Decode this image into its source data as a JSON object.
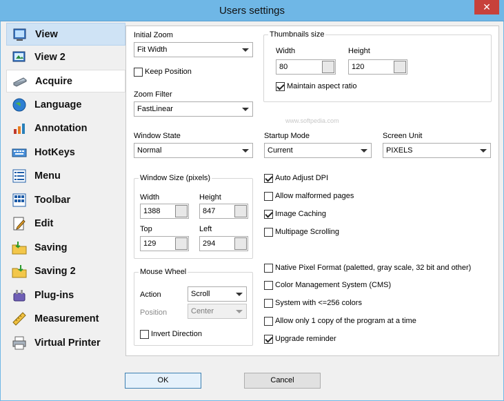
{
  "window": {
    "title": "Users settings",
    "close_glyph": "✕"
  },
  "nav": {
    "items": [
      {
        "label": "View",
        "icon": "view-icon"
      },
      {
        "label": "View 2",
        "icon": "view2-icon"
      },
      {
        "label": "Acquire",
        "icon": "scanner-icon"
      },
      {
        "label": "Language",
        "icon": "globe-icon"
      },
      {
        "label": "Annotation",
        "icon": "annotation-icon"
      },
      {
        "label": "HotKeys",
        "icon": "keyboard-icon"
      },
      {
        "label": "Menu",
        "icon": "menu-icon"
      },
      {
        "label": "Toolbar",
        "icon": "toolbar-icon"
      },
      {
        "label": "Edit",
        "icon": "edit-icon"
      },
      {
        "label": "Saving",
        "icon": "saving-icon"
      },
      {
        "label": "Saving 2",
        "icon": "saving2-icon"
      },
      {
        "label": "Plug-ins",
        "icon": "plugin-icon"
      },
      {
        "label": "Measurement",
        "icon": "ruler-icon"
      },
      {
        "label": "Virtual Printer",
        "icon": "printer-icon"
      }
    ],
    "active_index": 0,
    "selected_index": 2
  },
  "settings": {
    "initial_zoom": {
      "label": "Initial Zoom",
      "value": "Fit Width"
    },
    "keep_position": {
      "label": "Keep Position",
      "checked": false
    },
    "zoom_filter": {
      "label": "Zoom Filter",
      "value": "FastLinear"
    },
    "thumbnails": {
      "title": "Thumbnails size",
      "width_label": "Width",
      "width_value": "80",
      "height_label": "Height",
      "height_value": "120",
      "maintain_aspect": {
        "label": "Maintain aspect ratio",
        "checked": true
      }
    },
    "watermark": "www.softpedia.com",
    "window_state": {
      "label": "Window State",
      "value": "Normal"
    },
    "startup_mode": {
      "label": "Startup Mode",
      "value": "Current"
    },
    "screen_unit": {
      "label": "Screen Unit",
      "value": "PIXELS"
    },
    "window_size": {
      "title": "Window Size (pixels)",
      "width_label": "Width",
      "width_value": "1388",
      "height_label": "Height",
      "height_value": "847",
      "top_label": "Top",
      "top_value": "129",
      "left_label": "Left",
      "left_value": "294"
    },
    "mouse_wheel": {
      "title": "Mouse Wheel",
      "action_label": "Action",
      "action_value": "Scroll",
      "position_label": "Position",
      "position_value": "Center",
      "invert": {
        "label": "Invert Direction",
        "checked": false
      }
    },
    "checks": [
      {
        "label": "Auto Adjust DPI",
        "checked": true
      },
      {
        "label": "Allow malformed pages",
        "checked": false
      },
      {
        "label": "Image Caching",
        "checked": true
      },
      {
        "label": "Multipage Scrolling",
        "checked": false
      },
      {
        "label": "Native Pixel Format (paletted, gray scale, 32 bit and other)",
        "checked": false
      },
      {
        "label": "Color Management System (CMS)",
        "checked": false
      },
      {
        "label": "System with <=256 colors",
        "checked": false
      },
      {
        "label": "Allow only 1 copy of the program at a time",
        "checked": false
      },
      {
        "label": "Upgrade reminder",
        "checked": true
      }
    ]
  },
  "buttons": {
    "ok": "OK",
    "cancel": "Cancel"
  }
}
